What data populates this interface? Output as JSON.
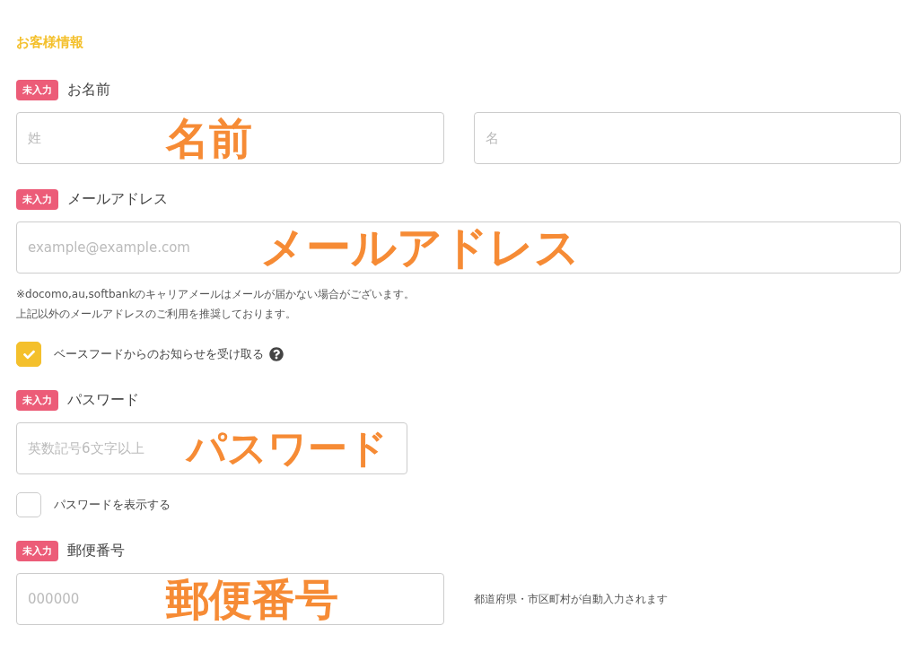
{
  "section_title": "お客様情報",
  "items": [
    {
      "kind": "pair",
      "badge": "未入力",
      "label": "お名前",
      "inputs": [
        {
          "placeholder": "姓"
        },
        {
          "placeholder": "名"
        }
      ],
      "annotation": "名前"
    },
    {
      "kind": "wide",
      "badge": "未入力",
      "label": "メールアドレス",
      "inputs": [
        {
          "placeholder": "example@example.com"
        }
      ],
      "annotation": "メールアドレス"
    },
    {
      "kind": "note",
      "lines": [
        "※docomo,au,softbankのキャリアメールはメールが届かない場合がございます。",
        "上記以外のメールアドレスのご利用を推奨しております。"
      ]
    },
    {
      "kind": "checkbox",
      "label": "ベースフードからのお知らせを受け取る",
      "checked": true,
      "help": true
    },
    {
      "kind": "short",
      "badge": "未入力",
      "label": "パスワード",
      "inputs": [
        {
          "placeholder": "英数記号6文字以上"
        }
      ],
      "annotation": "パスワード"
    },
    {
      "kind": "checkbox",
      "label": "パスワードを表示する",
      "checked": false,
      "help": false
    },
    {
      "kind": "hinted",
      "badge": "未入力",
      "label": "郵便番号",
      "inputs": [
        {
          "placeholder": "000000"
        }
      ],
      "annotation": "郵便番号",
      "hint": "都道府県・市区町村が自動入力されます"
    }
  ]
}
